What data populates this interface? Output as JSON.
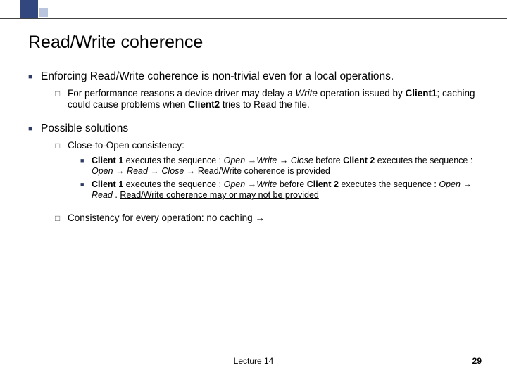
{
  "title": "Read/Write coherence",
  "points": {
    "p1": "Enforcing Read/Write coherence is non-trivial even for a local operations.",
    "p1a_pre": "For performance reasons a device driver may delay a ",
    "p1a_write": "Write",
    "p1a_mid": "  operation issued by ",
    "p1a_client1": "Client1",
    "p1a_mid2": "; caching could cause problems when ",
    "p1a_client2": "Client2",
    "p1a_tail": " tries to Read the file.",
    "p2": "Possible solutions",
    "p2a": "Close-to-Open consistency:",
    "p2a1_c1": "Client 1",
    "p2a1_seq": " executes the sequence : ",
    "p2a1_open": "Open ",
    "p2a1_arrow1": "→",
    "p2a1_write": "Write",
    "p2a1_arrow2": " → ",
    "p2a1_close": "Close",
    "p2a1_before": "   before ",
    "p2a1_c2": "Client 2",
    "p2a1_seq2": " executes the sequence : ",
    "p2a1_open2": "Open",
    "p2a1_arrow3": " → ",
    "p2a1_read": "Read",
    "p2a1_arrow4": " → ",
    "p2a1_close2": "Close",
    "p2a1_dot": "   ",
    "p2a1_arrow5": "→",
    "p2a1_concl": " Read/Write coherence is provided",
    "p2a2_c1": "Client 1",
    "p2a2_seq": " executes the sequence : ",
    "p2a2_open": "Open ",
    "p2a2_arrow1": "→",
    "p2a2_write": "Write",
    "p2a2_before": "   before ",
    "p2a2_c2": "Client 2",
    "p2a2_seq2": " executes the sequence : ",
    "p2a2_open2": "Open",
    "p2a2_arrow2": " → ",
    "p2a2_read": "Read",
    "p2a2_dot": " . ",
    "p2a2_concl": "Read/Write coherence may or may not be provided",
    "p2b_pre": "Consistency for every operation: no caching ",
    "p2b_arrow": "→"
  },
  "footer": {
    "center": "Lecture 14",
    "page": "29"
  }
}
